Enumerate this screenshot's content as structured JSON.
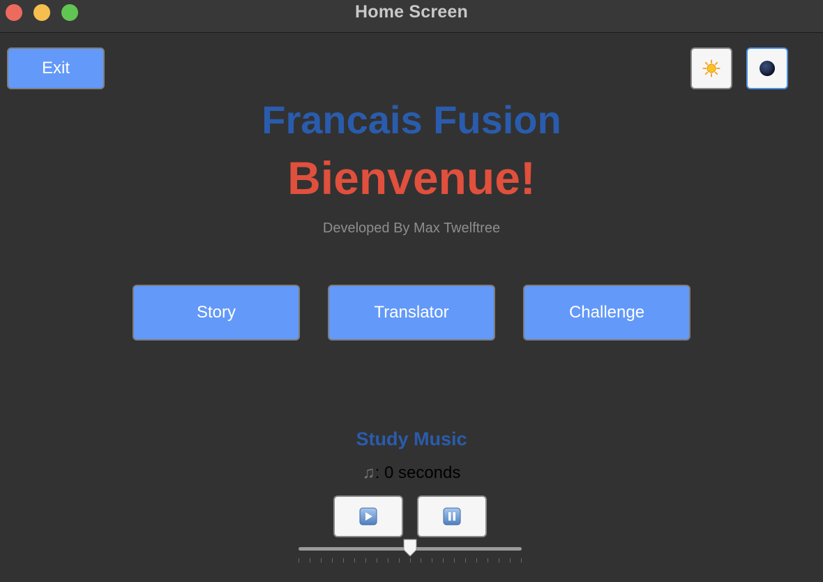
{
  "window": {
    "title": "Home Screen"
  },
  "header": {
    "exit_label": "Exit",
    "light_theme_icon": "sun-icon",
    "dark_theme_icon": "moon-icon"
  },
  "hero": {
    "app_title": "Francais Fusion",
    "welcome": "Bienvenue!",
    "developer": "Developed By Max Twelftree"
  },
  "nav": {
    "buttons": [
      {
        "label": "Story"
      },
      {
        "label": "Translator"
      },
      {
        "label": "Challenge"
      }
    ]
  },
  "music": {
    "title": "Study Music",
    "time_icon": "music-notes-icon",
    "time_text": ": 0 seconds",
    "play_icon": "play-icon",
    "pause_icon": "pause-icon",
    "volume_fraction": 0.5
  },
  "colors": {
    "accent_blue": "#6399f8",
    "title_blue": "#2a5cad",
    "welcome_red": "#e0503d",
    "background": "#323232"
  }
}
